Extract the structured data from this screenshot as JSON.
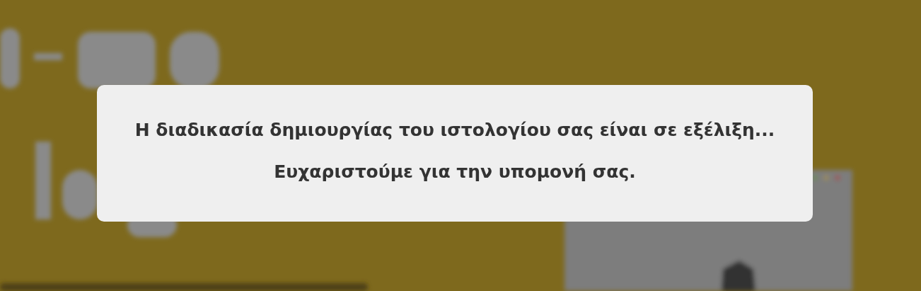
{
  "dialog": {
    "lines": [
      "Η διαδικασία δημιουργίας του ιστολογίου σας είναι σε εξέλιξη...",
      "Ευχαριστούμε για την υπομονή σας."
    ]
  }
}
